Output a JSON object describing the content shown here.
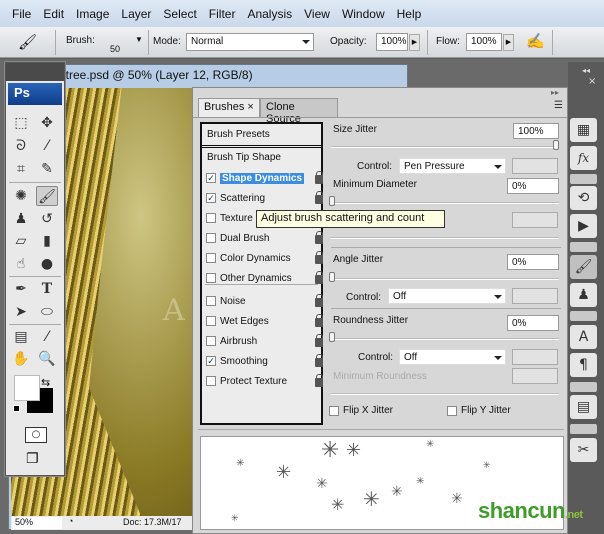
{
  "menubar": {
    "items": [
      "File",
      "Edit",
      "Image",
      "Layer",
      "Select",
      "Filter",
      "Analysis",
      "View",
      "Window",
      "Help"
    ]
  },
  "options": {
    "brush_label": "Brush:",
    "brush_size": "50",
    "mode_label": "Mode:",
    "mode_value": "Normal",
    "opacity_label": "Opacity:",
    "opacity_value": "100%",
    "flow_label": "Flow:",
    "flow_value": "100%"
  },
  "document": {
    "title": "_tree.psd @ 50% (Layer 12, RGB/8)",
    "canvas_text": "A",
    "zoom": "50%",
    "doc_info": "Doc: 17.3M/17"
  },
  "toolbox": {
    "logo": "Ps"
  },
  "brushes_panel": {
    "tabs": [
      "Brushes",
      "Clone Source"
    ],
    "presets": "Brush Presets",
    "tip_shape": "Brush Tip Shape",
    "options": [
      {
        "label": "Shape Dynamics",
        "checked": true,
        "active": true
      },
      {
        "label": "Scattering",
        "checked": true
      },
      {
        "label": "Texture",
        "checked": false
      },
      {
        "label": "Dual Brush",
        "checked": false
      },
      {
        "label": "Color Dynamics",
        "checked": false
      },
      {
        "label": "Other Dynamics",
        "checked": false
      },
      {
        "label": "Noise",
        "checked": false
      },
      {
        "label": "Wet Edges",
        "checked": false
      },
      {
        "label": "Airbrush",
        "checked": false
      },
      {
        "label": "Smoothing",
        "checked": true
      },
      {
        "label": "Protect Texture",
        "checked": false
      }
    ],
    "size_jitter": {
      "label": "Size Jitter",
      "value": "100%",
      "control_label": "Control:",
      "control": "Pen Pressure"
    },
    "min_diameter": {
      "label": "Minimum Diameter",
      "value": "0%"
    },
    "angle_jitter": {
      "label": "Angle Jitter",
      "value": "0%",
      "control_label": "Control:",
      "control": "Off"
    },
    "roundness_jitter": {
      "label": "Roundness Jitter",
      "value": "0%",
      "control_label": "Control:",
      "control": "Off"
    },
    "min_roundness": {
      "label": "Minimum Roundness"
    },
    "flip_x": "Flip X Jitter",
    "flip_y": "Flip Y Jitter",
    "tooltip": "Adjust brush scattering and count"
  },
  "watermark": {
    "text1": "shan",
    "text2": "cun",
    "text3": ".net"
  }
}
